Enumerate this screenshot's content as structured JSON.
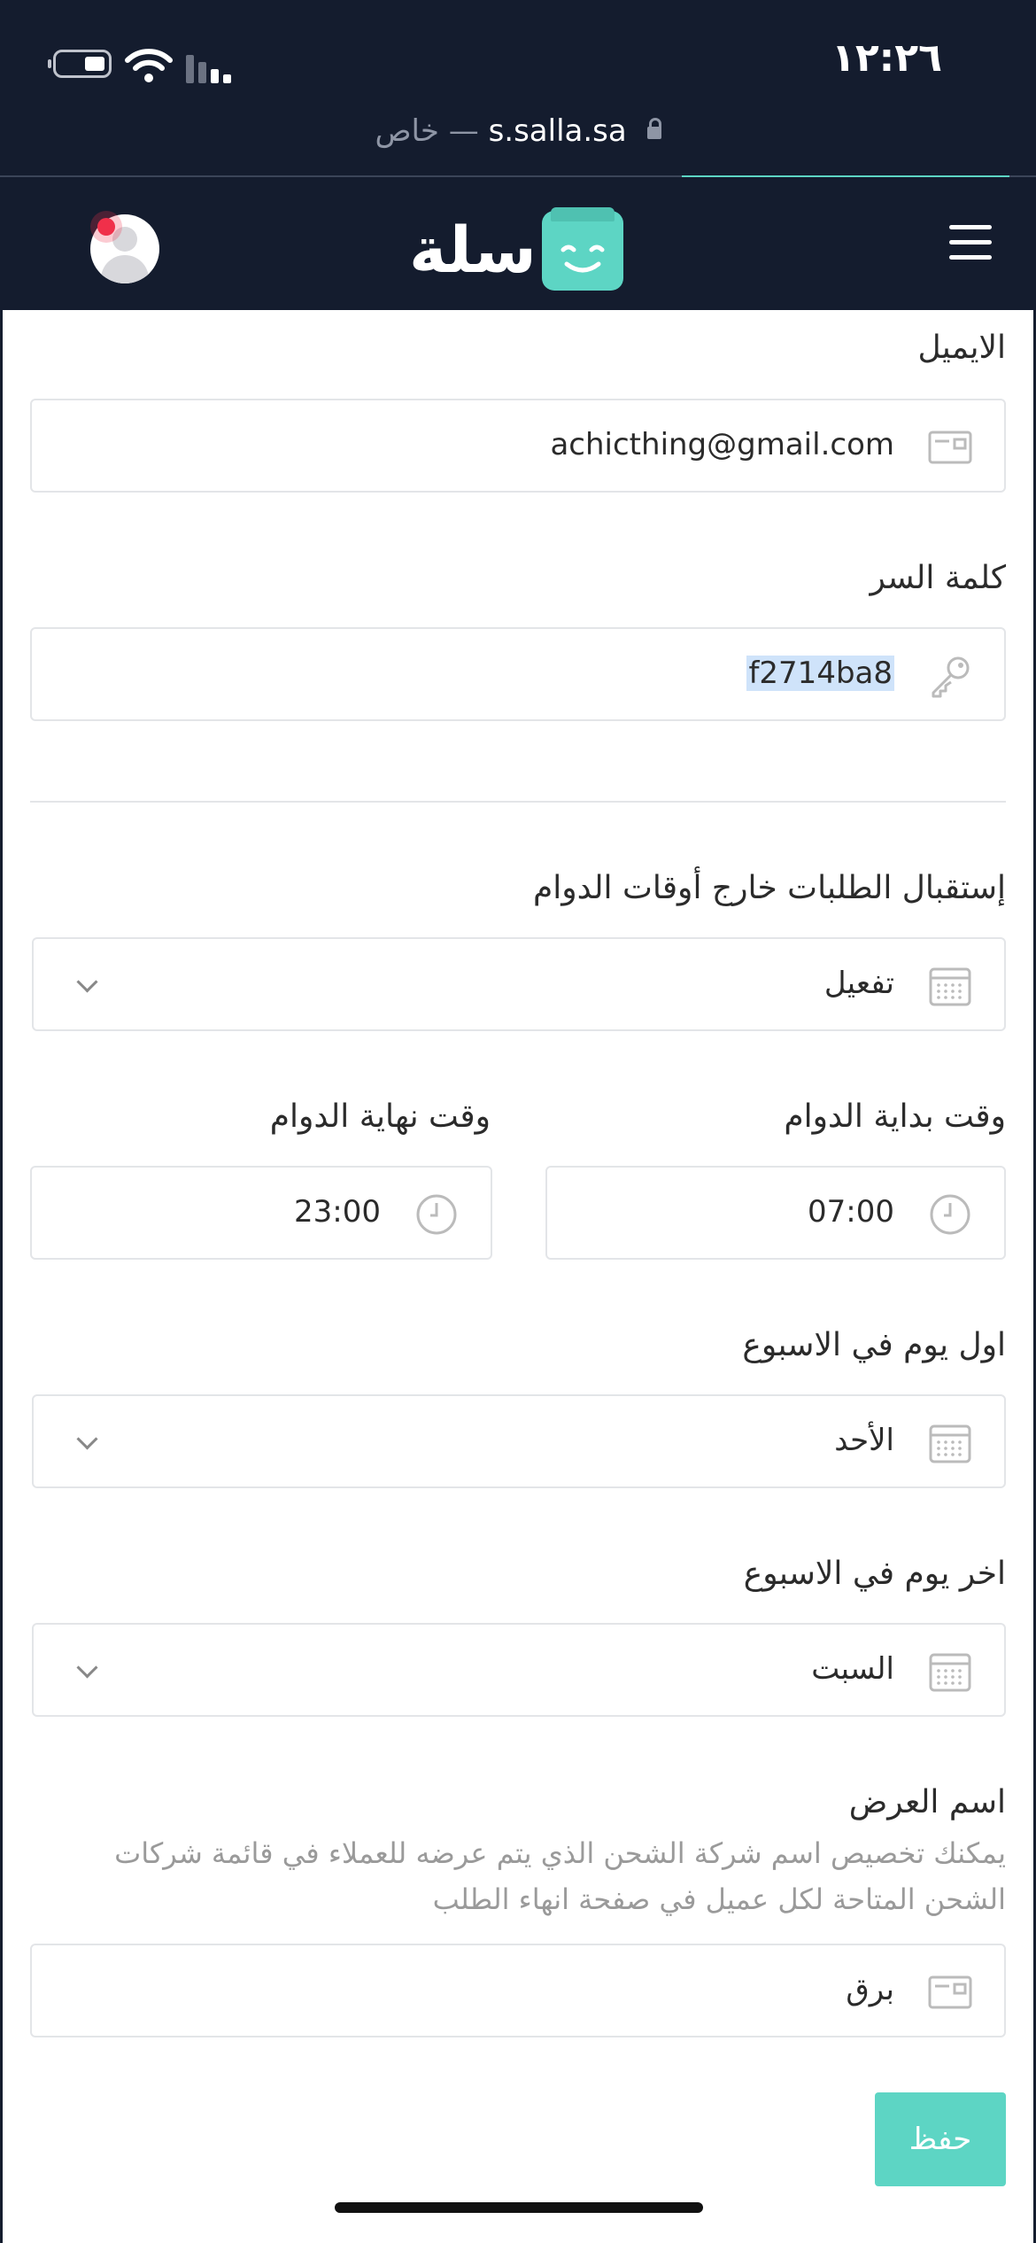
{
  "status": {
    "time": "١٢:٢٦",
    "url_domain": "s.salla.sa",
    "url_private": "خاص —"
  },
  "header": {
    "brand": "سلة",
    "icons": [
      "menu-icon",
      "salla-logo-icon",
      "avatar-icon"
    ]
  },
  "form": {
    "email": {
      "label": "الايميل",
      "value": "achicthing@gmail.com",
      "icon": "id-card-icon"
    },
    "password": {
      "label": "كلمة السر",
      "value": "f2714ba8",
      "icon": "key-icon"
    },
    "off_hours": {
      "label": "إستقبال الطلبات خارج أوقات الدوام",
      "value": "تفعيل",
      "icon": "calendar-icon"
    },
    "start_time": {
      "label": "وقت بداية الدوام",
      "value": "07:00",
      "icon": "clock-icon"
    },
    "end_time": {
      "label": "وقت نهاية الدوام",
      "value": "23:00",
      "icon": "clock-icon"
    },
    "first_day": {
      "label": "اول يوم في الاسبوع",
      "value": "الأحد",
      "icon": "calendar-icon"
    },
    "last_day": {
      "label": "اخر يوم في الاسبوع",
      "value": "السبت",
      "icon": "calendar-icon"
    },
    "display_name": {
      "label": "اسم العرض",
      "help_line1": "يمكنك تخصيص اسم شركة الشحن الذي يتم عرضه للعملاء في قائمة شركات",
      "help_line2": "الشحن المتاحة لكل عميل في صفحة انهاء الطلب",
      "value": "برق",
      "icon": "id-card-icon"
    },
    "save_label": "حفظ"
  },
  "colors": {
    "header_bg": "#141c2e",
    "accent": "#5dd5c4",
    "notification": "#f0304a"
  }
}
